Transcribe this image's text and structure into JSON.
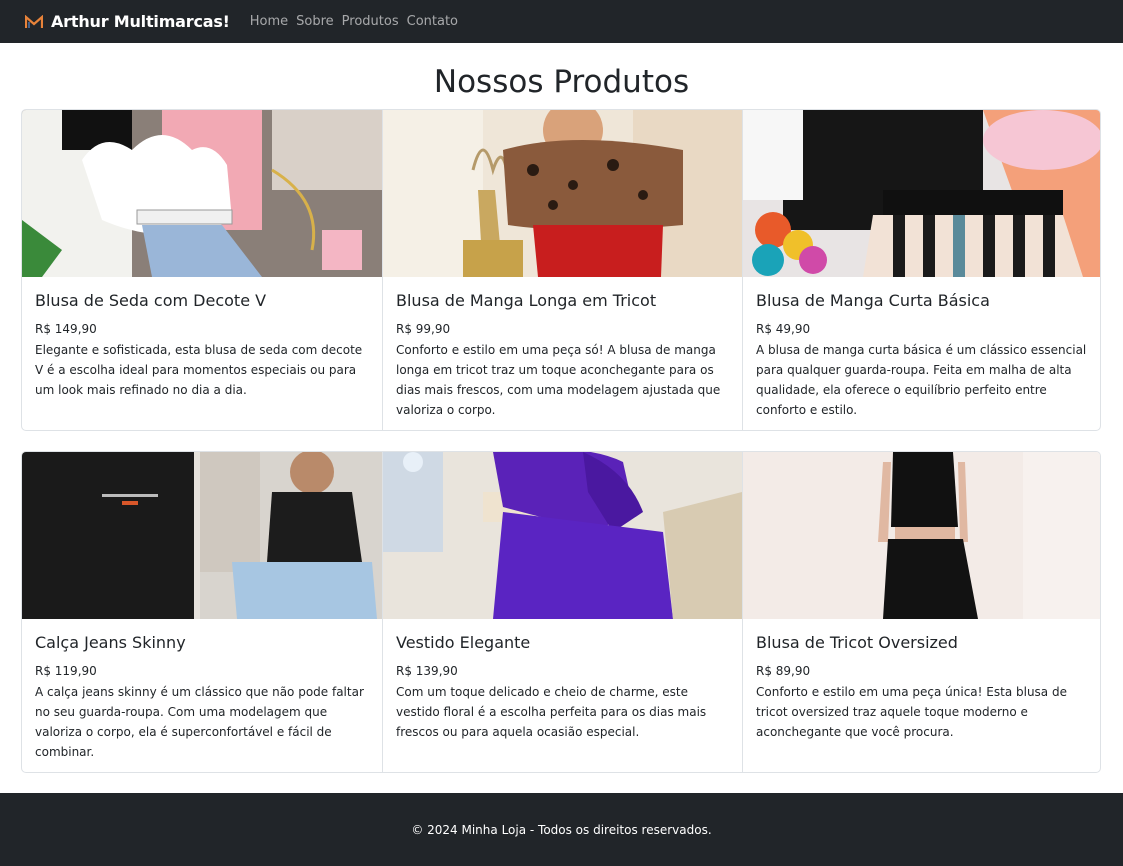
{
  "navbar": {
    "brand": "Arthur Multimarcas!",
    "links": [
      "Home",
      "Sobre",
      "Produtos",
      "Contato"
    ]
  },
  "page": {
    "title": "Nossos Produtos"
  },
  "products": [
    {
      "name": "Blusa de Seda com Decote V",
      "price": "R$ 149,90",
      "description": "Elegante e sofisticada, esta blusa de seda com decote V é a escolha ideal para momentos especiais ou para um look mais refinado no dia a dia."
    },
    {
      "name": "Blusa de Manga Longa em Tricot",
      "price": "R$ 99,90",
      "description": "Conforto e estilo em uma peça só! A blusa de manga longa em tricot traz um toque aconchegante para os dias mais frescos, com uma modelagem ajustada que valoriza o corpo."
    },
    {
      "name": "Blusa de Manga Curta Básica",
      "price": "R$ 49,90",
      "description": "A blusa de manga curta básica é um clássico essencial para qualquer guarda-roupa. Feita em malha de alta qualidade, ela oferece o equilíbrio perfeito entre conforto e estilo."
    },
    {
      "name": "Calça Jeans Skinny",
      "price": "R$ 119,90",
      "description": "A calça jeans skinny é um clássico que não pode faltar no seu guarda-roupa. Com uma modelagem que valoriza o corpo, ela é superconfortável e fácil de combinar."
    },
    {
      "name": "Vestido Elegante",
      "price": "R$ 139,90",
      "description": "Com um toque delicado e cheio de charme, este vestido floral é a escolha perfeita para os dias mais frescos ou para aquela ocasião especial."
    },
    {
      "name": "Blusa de Tricot Oversized",
      "price": "R$ 89,90",
      "description": "Conforto e estilo em uma peça única! Esta blusa de tricot oversized traz aquele toque moderno e aconchegante que você procura."
    }
  ],
  "footer": {
    "text": "© 2024 Minha Loja - Todos os direitos reservados."
  }
}
